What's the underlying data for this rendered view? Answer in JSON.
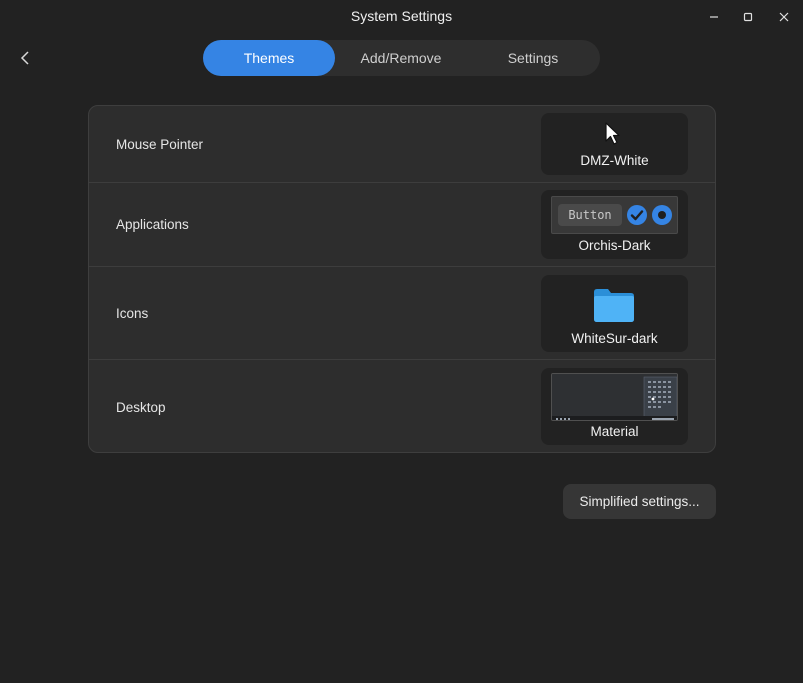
{
  "window": {
    "title": "System Settings"
  },
  "tabs": [
    {
      "label": "Themes",
      "active": true
    },
    {
      "label": "Add/Remove",
      "active": false
    },
    {
      "label": "Settings",
      "active": false
    }
  ],
  "rows": [
    {
      "label": "Mouse Pointer",
      "value": "DMZ-White",
      "preview_icon": "cursor-arrow-icon"
    },
    {
      "label": "Applications",
      "value": "Orchis-Dark",
      "preview_button_label": "Button"
    },
    {
      "label": "Icons",
      "value": "WhiteSur-dark",
      "preview_icon": "folder-icon"
    },
    {
      "label": "Desktop",
      "value": "Material",
      "preview_icon": "desktop-wallpaper-preview"
    }
  ],
  "simplified_button": {
    "label": "Simplified settings..."
  },
  "colors": {
    "accent": "#3584e4",
    "folder": "#4fb3f6",
    "background": "#222222",
    "card": "#2d2d2d"
  }
}
